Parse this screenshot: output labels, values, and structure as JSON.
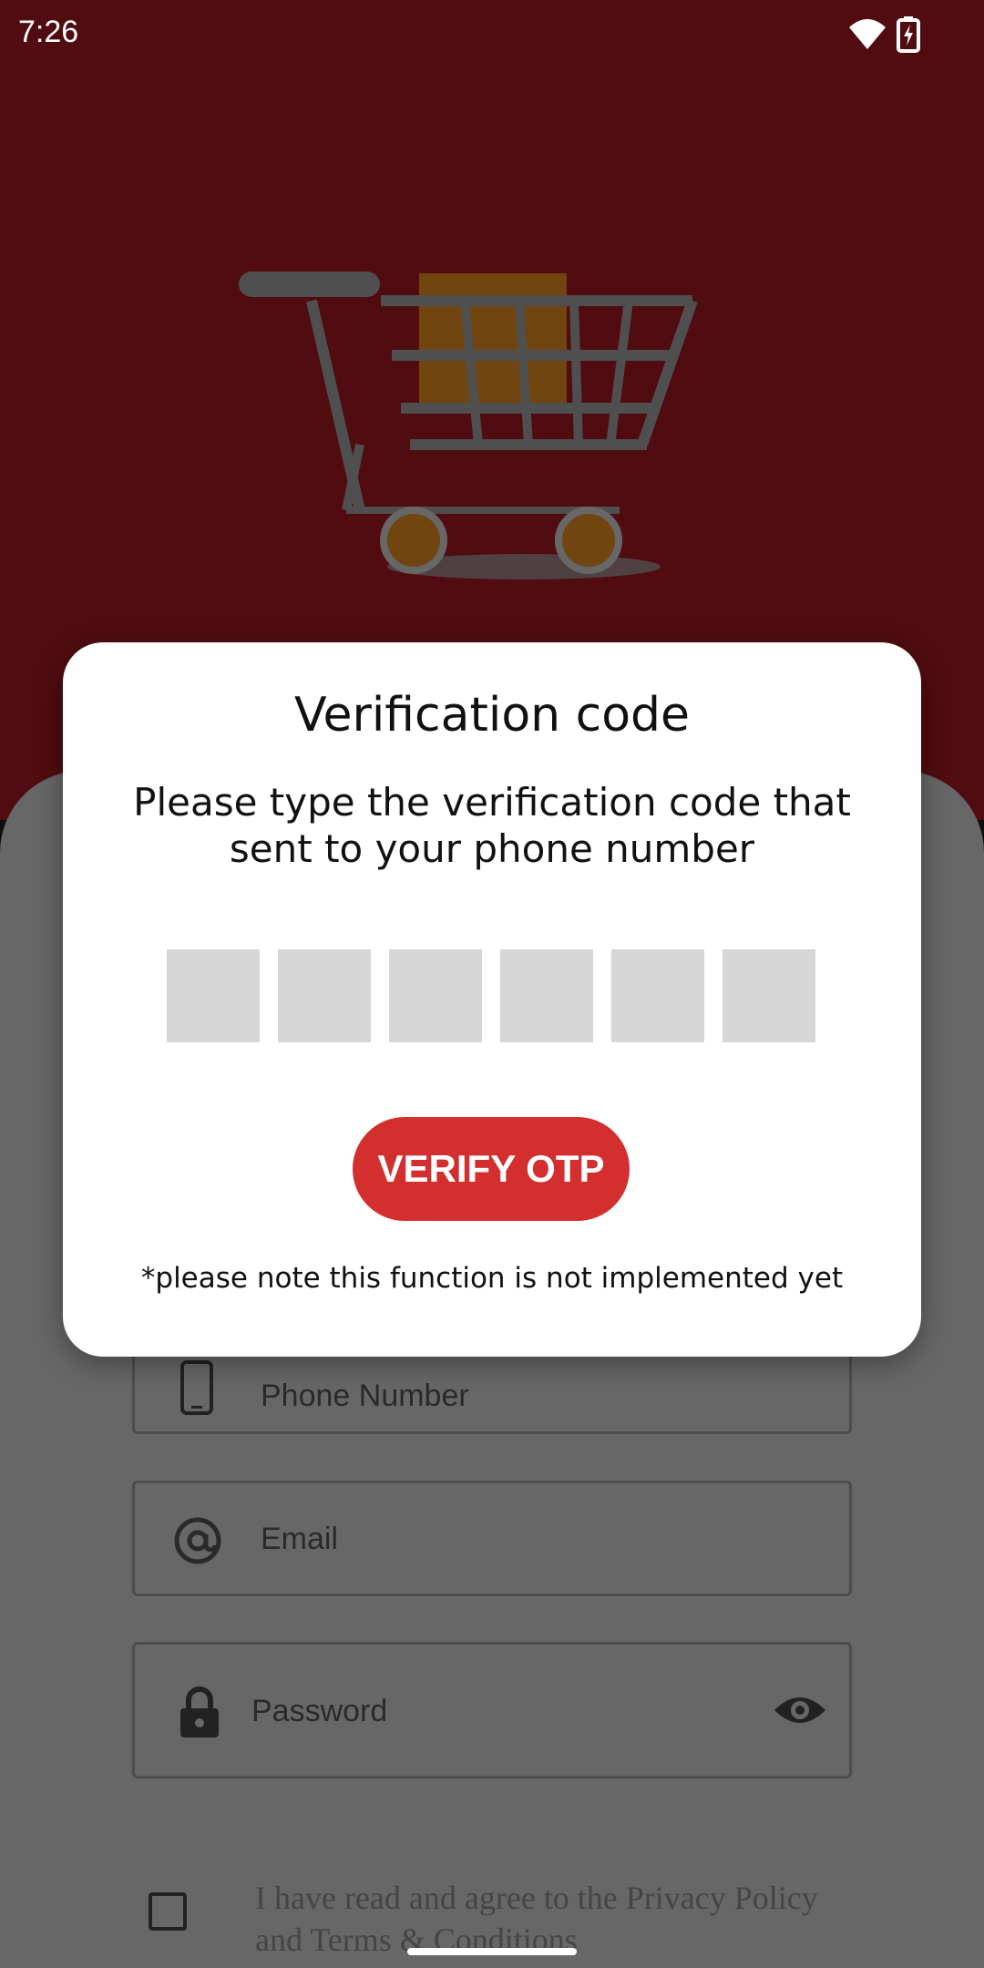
{
  "status_bar": {
    "time": "7:26",
    "icons": [
      "wifi-icon",
      "battery-charging-icon"
    ]
  },
  "illustration": {
    "name": "shopping-cart-illustration",
    "colors": {
      "cart": "#9e9e9e",
      "box": "#e08a1e"
    }
  },
  "form": {
    "phone_label": "Phone Number",
    "email_label": "Email",
    "password_label": "Password",
    "agree_text_line1": "I have read and agree to the Privacy Policy",
    "agree_text_line2": "and Terms & Conditions"
  },
  "dialog": {
    "title": "Verification code",
    "message": "Please type the verification code that sent to your phone number",
    "otp_values": [
      "",
      "",
      "",
      "",
      "",
      ""
    ],
    "verify_label": "VERIFY OTP",
    "note": "*please note this function is not implemented yet"
  },
  "colors": {
    "brand": "#a01820",
    "accent": "#d32f2f",
    "otp_box": "#d6d6d6"
  }
}
